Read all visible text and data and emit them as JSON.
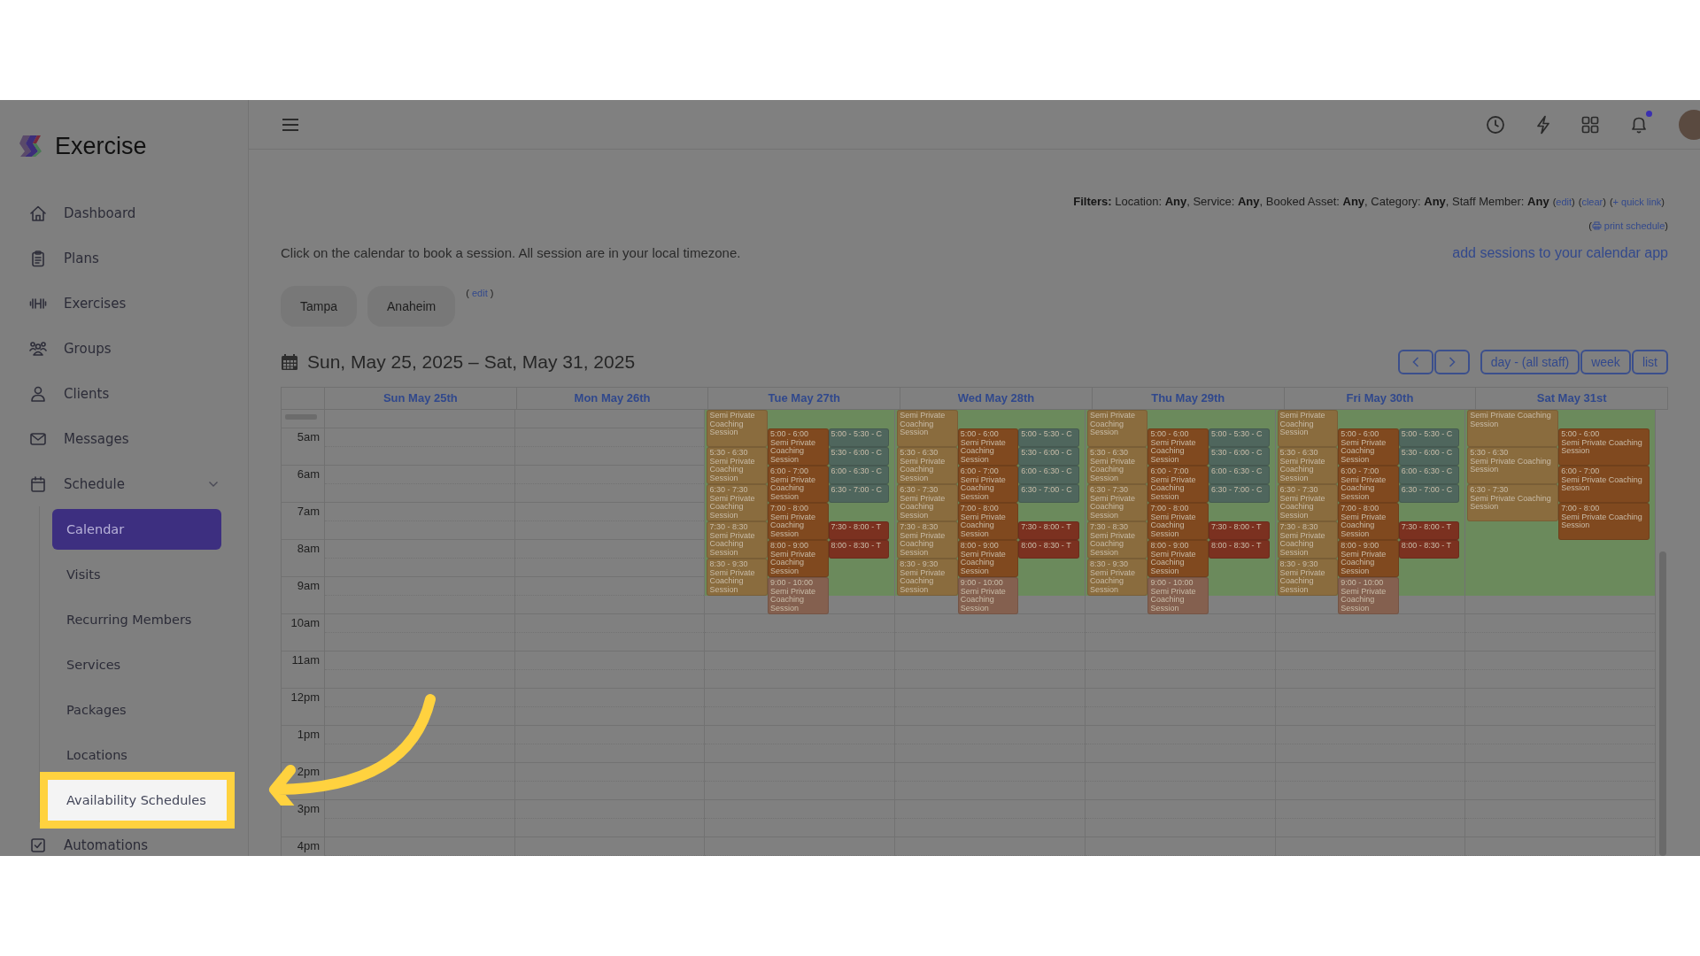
{
  "sidebar": {
    "brand": "Exercise",
    "items": [
      {
        "label": "Dashboard",
        "selected": false
      },
      {
        "label": "Plans",
        "selected": false
      },
      {
        "label": "Exercises",
        "selected": false
      },
      {
        "label": "Groups",
        "selected": false
      },
      {
        "label": "Clients",
        "selected": false
      },
      {
        "label": "Messages",
        "selected": false
      },
      {
        "label": "Schedule",
        "selected": false,
        "expanded": true,
        "children": [
          {
            "label": "Calendar",
            "selected": true,
            "highlighted": false
          },
          {
            "label": "Visits",
            "selected": false,
            "highlighted": false
          },
          {
            "label": "Recurring Members",
            "selected": false,
            "highlighted": false
          },
          {
            "label": "Services",
            "selected": false,
            "highlighted": false
          },
          {
            "label": "Packages",
            "selected": false,
            "highlighted": false
          },
          {
            "label": "Locations",
            "selected": false,
            "highlighted": false
          },
          {
            "label": "Availability Schedules",
            "selected": false,
            "highlighted": true
          }
        ]
      },
      {
        "label": "Automations",
        "selected": false
      }
    ]
  },
  "topbar": {
    "unread": true
  },
  "filters": {
    "text": "**Filters:** Location: **Any**, Service: **Any**, Booked Asset: **Any**, Category: **Any**, Staff Member: **Any**",
    "links": [
      {
        "before": "(",
        "label": "edit",
        "after": ")"
      },
      {
        "before": "(",
        "label": "clear",
        "after": ")"
      },
      {
        "before": "(",
        "label": "+ quick link",
        "after": ")"
      }
    ]
  },
  "print_link": {
    "before": "(",
    "label": "print schedule",
    "after": ")"
  },
  "instructions": "Click on the calendar to book a session. All session are in your local timezone.",
  "calendar_link": "add sessions to your calendar app",
  "locations": [
    {
      "label": "Tampa"
    },
    {
      "label": "Anaheim"
    }
  ],
  "locations_edit": {
    "before": "(",
    "label": "edit",
    "after": ")"
  },
  "calendar": {
    "title": "Sun, May 25, 2025 – Sat, May 31, 2025",
    "views": [
      {
        "label": "day - (all staff)"
      },
      {
        "label": "week"
      },
      {
        "label": "list"
      }
    ],
    "times": [
      "5am",
      "6am",
      "7am",
      "8am",
      "9am",
      "10am",
      "11am",
      "12pm",
      "1pm",
      "2pm",
      "3pm",
      "4pm"
    ],
    "days": [
      {
        "label": "Sun May 25th",
        "available": false
      },
      {
        "label": "Mon May 26th",
        "available": false
      },
      {
        "label": "Tue May 27th",
        "available": true,
        "lanes": [
          [
            {
              "kind": "hour",
              "title": "Semi Private Coaching Session",
              "color": "#8a6c3e"
            },
            {
              "kind": "hour",
              "time": "5:30 - 6:30",
              "title": "Semi Private Coaching Session",
              "color": "#8a6c3e"
            },
            {
              "kind": "hour",
              "time": "6:30 - 7:30",
              "title": "Semi Private Coaching Session",
              "color": "#8a6c3e"
            },
            {
              "kind": "hour",
              "time": "7:30 - 8:30",
              "title": "Semi Private Coaching Session",
              "color": "#8a6c3e"
            },
            {
              "kind": "hour",
              "time": "8:30 - 9:30",
              "title": "Semi Private Coaching Session",
              "color": "#8a6c3e"
            }
          ],
          [
            {
              "kind": "gap"
            },
            {
              "kind": "hour",
              "time": "5:00 - 6:00",
              "title": "Semi Private Coaching Session",
              "color": "#80491f"
            },
            {
              "kind": "hour",
              "time": "6:00 - 7:00",
              "title": "Semi Private Coaching Session",
              "color": "#80491f"
            },
            {
              "kind": "hour",
              "time": "7:00 - 8:00",
              "title": "Semi Private Coaching Session",
              "color": "#80491f"
            },
            {
              "kind": "hour",
              "time": "8:00 - 9:00",
              "title": "Semi Private Coaching Session",
              "color": "#80491f"
            },
            {
              "kind": "hour",
              "time": "9:00 - 10:00",
              "title": "Semi Private Coaching Session",
              "color": "#84604f"
            }
          ],
          [
            {
              "kind": "gap"
            },
            {
              "kind": "half",
              "time": "5:00 - 5:30 - C",
              "color": "#4f665d"
            },
            {
              "kind": "half",
              "time": "5:30 - 6:00 - C",
              "color": "#4f665d"
            },
            {
              "kind": "half",
              "time": "6:00 - 6:30 - C",
              "color": "#4f665d"
            },
            {
              "kind": "half",
              "time": "6:30 - 7:00 - C",
              "color": "#4f665d"
            },
            {
              "kind": "gap"
            },
            {
              "kind": "half",
              "time": "7:30 - 8:00 - T",
              "color": "#7b3120"
            },
            {
              "kind": "half",
              "time": "8:00 - 8:30 - T",
              "color": "#7b3120"
            }
          ]
        ]
      },
      {
        "label": "Wed May 28th",
        "available": true,
        "lanes": [
          [
            {
              "kind": "hour",
              "title": "Semi Private Coaching Session",
              "color": "#8a6c3e"
            },
            {
              "kind": "hour",
              "time": "5:30 - 6:30",
              "title": "Semi Private Coaching Session",
              "color": "#8a6c3e"
            },
            {
              "kind": "hour",
              "time": "6:30 - 7:30",
              "title": "Semi Private Coaching Session",
              "color": "#8a6c3e"
            },
            {
              "kind": "hour",
              "time": "7:30 - 8:30",
              "title": "Semi Private Coaching Session",
              "color": "#8a6c3e"
            },
            {
              "kind": "hour",
              "time": "8:30 - 9:30",
              "title": "Semi Private Coaching Session",
              "color": "#8a6c3e"
            }
          ],
          [
            {
              "kind": "gap"
            },
            {
              "kind": "hour",
              "time": "5:00 - 6:00",
              "title": "Semi Private Coaching Session",
              "color": "#80491f"
            },
            {
              "kind": "hour",
              "time": "6:00 - 7:00",
              "title": "Semi Private Coaching Session",
              "color": "#80491f"
            },
            {
              "kind": "hour",
              "time": "7:00 - 8:00",
              "title": "Semi Private Coaching Session",
              "color": "#80491f"
            },
            {
              "kind": "hour",
              "time": "8:00 - 9:00",
              "title": "Semi Private Coaching Session",
              "color": "#80491f"
            },
            {
              "kind": "hour",
              "time": "9:00 - 10:00",
              "title": "Semi Private Coaching Session",
              "color": "#84604f"
            }
          ],
          [
            {
              "kind": "gap"
            },
            {
              "kind": "half",
              "time": "5:00 - 5:30 - C",
              "color": "#4f665d"
            },
            {
              "kind": "half",
              "time": "5:30 - 6:00 - C",
              "color": "#4f665d"
            },
            {
              "kind": "half",
              "time": "6:00 - 6:30 - C",
              "color": "#4f665d"
            },
            {
              "kind": "half",
              "time": "6:30 - 7:00 - C",
              "color": "#4f665d"
            },
            {
              "kind": "gap"
            },
            {
              "kind": "half",
              "time": "7:30 - 8:00 - T",
              "color": "#7b3120"
            },
            {
              "kind": "half",
              "time": "8:00 - 8:30 - T",
              "color": "#7b3120"
            }
          ]
        ]
      },
      {
        "label": "Thu May 29th",
        "available": true,
        "lanes": [
          [
            {
              "kind": "hour",
              "title": "Semi Private Coaching Session",
              "color": "#8a6c3e"
            },
            {
              "kind": "hour",
              "time": "5:30 - 6:30",
              "title": "Semi Private Coaching Session",
              "color": "#8a6c3e"
            },
            {
              "kind": "hour",
              "time": "6:30 - 7:30",
              "title": "Semi Private Coaching Session",
              "color": "#8a6c3e"
            },
            {
              "kind": "hour",
              "time": "7:30 - 8:30",
              "title": "Semi Private Coaching Session",
              "color": "#8a6c3e"
            },
            {
              "kind": "hour",
              "time": "8:30 - 9:30",
              "title": "Semi Private Coaching Session",
              "color": "#8a6c3e"
            }
          ],
          [
            {
              "kind": "gap"
            },
            {
              "kind": "hour",
              "time": "5:00 - 6:00",
              "title": "Semi Private Coaching Session",
              "color": "#80491f"
            },
            {
              "kind": "hour",
              "time": "6:00 - 7:00",
              "title": "Semi Private Coaching Session",
              "color": "#80491f"
            },
            {
              "kind": "hour",
              "time": "7:00 - 8:00",
              "title": "Semi Private Coaching Session",
              "color": "#80491f"
            },
            {
              "kind": "hour",
              "time": "8:00 - 9:00",
              "title": "Semi Private Coaching Session",
              "color": "#80491f"
            },
            {
              "kind": "hour",
              "time": "9:00 - 10:00",
              "title": "Semi Private Coaching Session",
              "color": "#84604f"
            }
          ],
          [
            {
              "kind": "gap"
            },
            {
              "kind": "half",
              "time": "5:00 - 5:30 - C",
              "color": "#4f665d"
            },
            {
              "kind": "half",
              "time": "5:30 - 6:00 - C",
              "color": "#4f665d"
            },
            {
              "kind": "half",
              "time": "6:00 - 6:30 - C",
              "color": "#4f665d"
            },
            {
              "kind": "half",
              "time": "6:30 - 7:00 - C",
              "color": "#4f665d"
            },
            {
              "kind": "gap"
            },
            {
              "kind": "half",
              "time": "7:30 - 8:00 - T",
              "color": "#7b3120"
            },
            {
              "kind": "half",
              "time": "8:00 - 8:30 - T",
              "color": "#7b3120"
            }
          ]
        ]
      },
      {
        "label": "Fri May 30th",
        "available": true,
        "lanes": [
          [
            {
              "kind": "hour",
              "title": "Semi Private Coaching Session",
              "color": "#8a6c3e"
            },
            {
              "kind": "hour",
              "time": "5:30 - 6:30",
              "title": "Semi Private Coaching Session",
              "color": "#8a6c3e"
            },
            {
              "kind": "hour",
              "time": "6:30 - 7:30",
              "title": "Semi Private Coaching Session",
              "color": "#8a6c3e"
            },
            {
              "kind": "hour",
              "time": "7:30 - 8:30",
              "title": "Semi Private Coaching Session",
              "color": "#8a6c3e"
            },
            {
              "kind": "hour",
              "time": "8:30 - 9:30",
              "title": "Semi Private Coaching Session",
              "color": "#8a6c3e"
            }
          ],
          [
            {
              "kind": "gap"
            },
            {
              "kind": "hour",
              "time": "5:00 - 6:00",
              "title": "Semi Private Coaching Session",
              "color": "#80491f"
            },
            {
              "kind": "hour",
              "time": "6:00 - 7:00",
              "title": "Semi Private Coaching Session",
              "color": "#80491f"
            },
            {
              "kind": "hour",
              "time": "7:00 - 8:00",
              "title": "Semi Private Coaching Session",
              "color": "#80491f"
            },
            {
              "kind": "hour",
              "time": "8:00 - 9:00",
              "title": "Semi Private Coaching Session",
              "color": "#80491f"
            },
            {
              "kind": "hour",
              "time": "9:00 - 10:00",
              "title": "Semi Private Coaching Session",
              "color": "#84604f"
            }
          ],
          [
            {
              "kind": "gap"
            },
            {
              "kind": "half",
              "time": "5:00 - 5:30 - C",
              "color": "#4f665d"
            },
            {
              "kind": "half",
              "time": "5:30 - 6:00 - C",
              "color": "#4f665d"
            },
            {
              "kind": "half",
              "time": "6:00 - 6:30 - C",
              "color": "#4f665d"
            },
            {
              "kind": "half",
              "time": "6:30 - 7:00 - C",
              "color": "#4f665d"
            },
            {
              "kind": "gap"
            },
            {
              "kind": "half",
              "time": "7:30 - 8:00 - T",
              "color": "#7b3120"
            },
            {
              "kind": "half",
              "time": "8:00 - 8:30 - T",
              "color": "#7b3120"
            }
          ]
        ]
      },
      {
        "label": "Sat May 31st",
        "available": true,
        "lanes": [
          [
            {
              "kind": "hour",
              "title": "Semi Private Coaching Session",
              "color": "#8a6c3e"
            },
            {
              "kind": "hour",
              "time": "5:30 - 6:30",
              "title": "Semi Private Coaching Session",
              "color": "#8a6c3e"
            },
            {
              "kind": "hour",
              "time": "6:30 - 7:30",
              "title": "Semi Private Coaching Session",
              "color": "#8a6c3e"
            }
          ],
          [
            {
              "kind": "gap"
            },
            {
              "kind": "hour",
              "time": "5:00 - 6:00",
              "title": "Semi Private Coaching Session",
              "color": "#80491f"
            },
            {
              "kind": "hour",
              "time": "6:00 - 7:00",
              "title": "Semi Private Coaching Session",
              "color": "#80491f"
            },
            {
              "kind": "hour",
              "time": "7:00 - 8:00",
              "title": "Semi Private Coaching Session",
              "color": "#80491f"
            }
          ]
        ]
      }
    ]
  }
}
